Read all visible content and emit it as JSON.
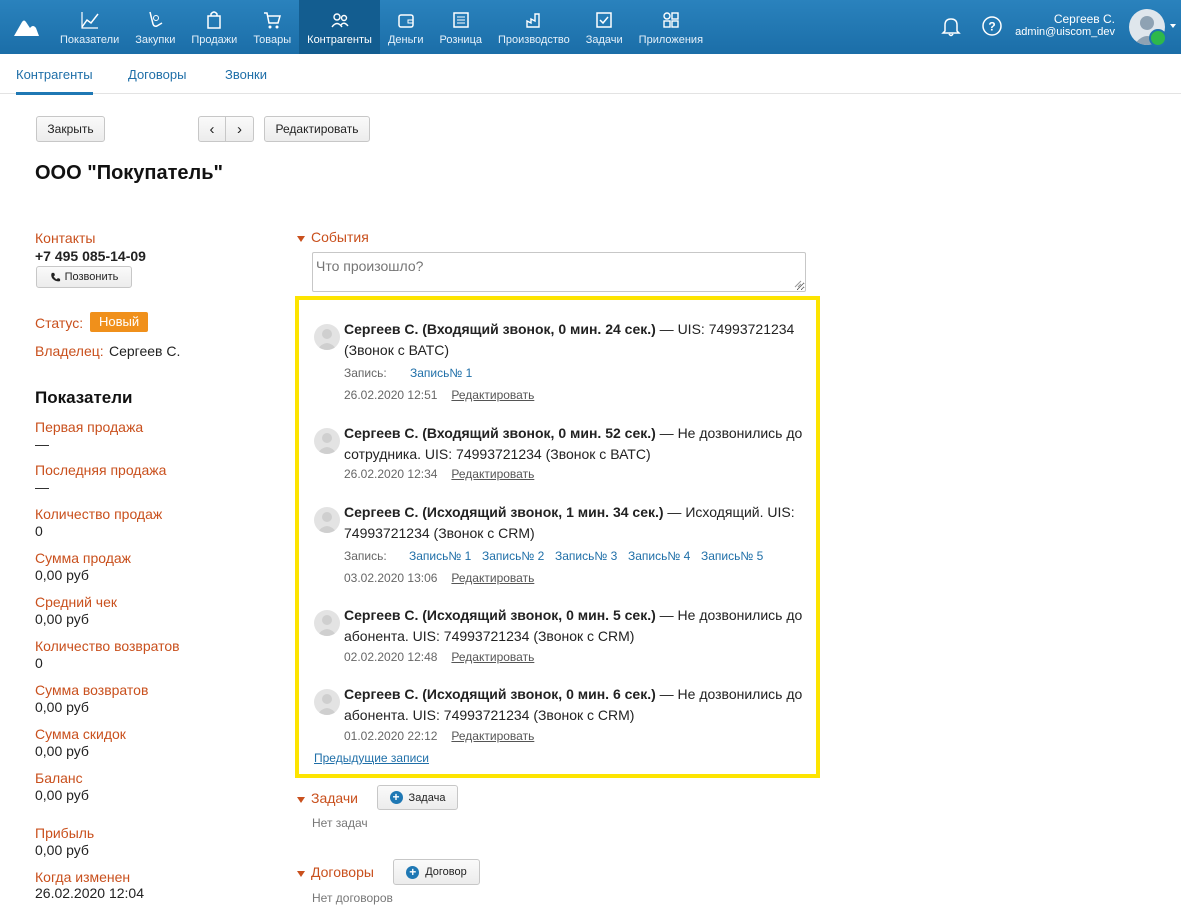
{
  "topnav": {
    "items": [
      {
        "label": "Показатели",
        "icon": "chart-icon"
      },
      {
        "label": "Закупки",
        "icon": "basket-icon"
      },
      {
        "label": "Продажи",
        "icon": "bag-icon"
      },
      {
        "label": "Товары",
        "icon": "cart-icon"
      },
      {
        "label": "Контрагенты",
        "icon": "people-icon"
      },
      {
        "label": "Деньги",
        "icon": "wallet-icon"
      },
      {
        "label": "Розница",
        "icon": "register-icon"
      },
      {
        "label": "Производство",
        "icon": "factory-icon"
      },
      {
        "label": "Задачи",
        "icon": "check-icon"
      },
      {
        "label": "Приложения",
        "icon": "apps-icon"
      }
    ],
    "active": "Контрагенты"
  },
  "user": {
    "name": "Сергеев С.",
    "login": "admin@uiscom_dev"
  },
  "subtabs": [
    {
      "label": "Контрагенты"
    },
    {
      "label": "Договоры"
    },
    {
      "label": "Звонки"
    }
  ],
  "toolbar": {
    "close": "Закрыть",
    "prev": "‹",
    "next": "›",
    "edit": "Редактировать"
  },
  "title": "ООО \"Покупатель\"",
  "contacts": {
    "label": "Контакты",
    "phone": "+7 495 085-14-09",
    "call_button": "Позвонить"
  },
  "status": {
    "label": "Статус:",
    "value": "Новый"
  },
  "owner": {
    "label": "Владелец:",
    "value": "Сергеев С."
  },
  "indicators": {
    "title": "Показатели",
    "items": [
      {
        "label": "Первая продажа",
        "value": "—"
      },
      {
        "label": "Последняя продажа",
        "value": "—"
      },
      {
        "label": "Количество продаж",
        "value": "0"
      },
      {
        "label": "Сумма продаж",
        "value": "0,00 руб"
      },
      {
        "label": "Средний чек",
        "value": "0,00 руб"
      },
      {
        "label": "Количество возвратов",
        "value": "0"
      },
      {
        "label": "Сумма возвратов",
        "value": "0,00 руб"
      },
      {
        "label": "Сумма скидок",
        "value": "0,00 руб"
      },
      {
        "label": "Баланс",
        "value": "0,00 руб"
      },
      {
        "label": "Прибыль",
        "value": "0,00 руб"
      },
      {
        "label": "Когда изменен",
        "value": "26.02.2020 12:04"
      }
    ]
  },
  "events": {
    "title": "События",
    "placeholder": "Что произошло?",
    "record_label": "Запись:",
    "edit_label": "Редактировать",
    "prev_link": "Предыдущие записи",
    "list": [
      {
        "author": "Сергеев С. (Входящий звонок, 0 мин. 24 сек.)",
        "text": " — UIS: 74993721234 (Звонок с ВАТС)",
        "records": [
          "Запись№ 1"
        ],
        "time": "26.02.2020 12:51"
      },
      {
        "author": "Сергеев С. (Входящий звонок, 0 мин. 52 сек.)",
        "text": " — Не дозвонились до сотрудника.  UIS: 74993721234 (Звонок с ВАТС)",
        "records": [],
        "time": "26.02.2020 12:34"
      },
      {
        "author": "Сергеев С. (Исходящий звонок, 1 мин. 34 сек.)",
        "text": " — Исходящий. UIS: 74993721234 (Звонок с CRM)",
        "records": [
          "Запись№ 1",
          "Запись№ 2",
          "Запись№ 3",
          "Запись№ 4",
          "Запись№ 5"
        ],
        "time": "03.02.2020 13:06"
      },
      {
        "author": "Сергеев С. (Исходящий звонок, 0 мин. 5 сек.)",
        "text": " — Не дозвонились до абонента.  UIS: 74993721234 (Звонок с CRM)",
        "records": [],
        "time": "02.02.2020 12:48"
      },
      {
        "author": "Сергеев С. (Исходящий звонок, 0 мин. 6 сек.)",
        "text": " — Не дозвонились до абонента.  UIS: 74993721234 (Звонок с CRM)",
        "records": [],
        "time": "01.02.2020 22:12"
      }
    ]
  },
  "tasks": {
    "title": "Задачи",
    "button": "Задача",
    "empty": "Нет задач"
  },
  "contracts": {
    "title": "Договоры",
    "button": "Договор",
    "empty": "Нет договоров"
  },
  "colors": {
    "topbar": "#1f78b4",
    "accent_label": "#c9501d",
    "status_badge": "#f0901b",
    "highlight": "#fde400",
    "link": "#1f6fa8"
  }
}
